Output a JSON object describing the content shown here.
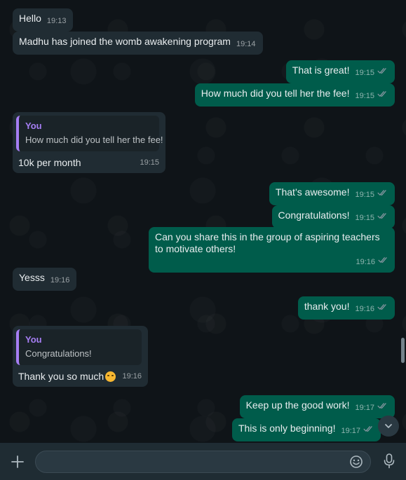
{
  "messages": [
    {
      "dir": "in",
      "text": "Hello",
      "time": "19:13"
    },
    {
      "dir": "in",
      "text": "Madhu has joined the womb awakening program",
      "time": "19:14"
    },
    {
      "dir": "out",
      "text": "That is great!",
      "time": "19:15"
    },
    {
      "dir": "out",
      "text": "How much did you tell her the fee!",
      "time": "19:15"
    },
    {
      "dir": "in",
      "quote_name": "You",
      "quote_text": "How much did you tell her the fee!",
      "text": "10k per month",
      "time": "19:15"
    },
    {
      "dir": "out",
      "text": "That’s awesome!",
      "time": "19:15"
    },
    {
      "dir": "out",
      "text": "Congratulations!",
      "time": "19:15"
    },
    {
      "dir": "out",
      "text": "Can you share this in the group of aspiring teachers to motivate others!",
      "time": "19:16"
    },
    {
      "dir": "in",
      "text": "Yesss",
      "time": "19:16"
    },
    {
      "dir": "out",
      "text": "thank you!",
      "time": "19:16"
    },
    {
      "dir": "in",
      "quote_name": "You",
      "quote_text": "Congratulations!",
      "text": "Thank you so much",
      "emoji": "smiling-face-emoji",
      "time": "19:16"
    },
    {
      "dir": "out",
      "text": "Keep up the good work!",
      "time": "19:17"
    },
    {
      "dir": "out",
      "text": "This is only beginning!",
      "time": "19:17"
    }
  ],
  "composer": {
    "placeholder": "",
    "value": "",
    "icons": [
      "plus-icon",
      "emoji-icon",
      "microphone-icon"
    ]
  },
  "colors": {
    "incoming_bubble": "#202c33",
    "outgoing_bubble": "#005c4b",
    "quote_accent": "#a67ef4",
    "read_ticks": "#8696a0"
  }
}
